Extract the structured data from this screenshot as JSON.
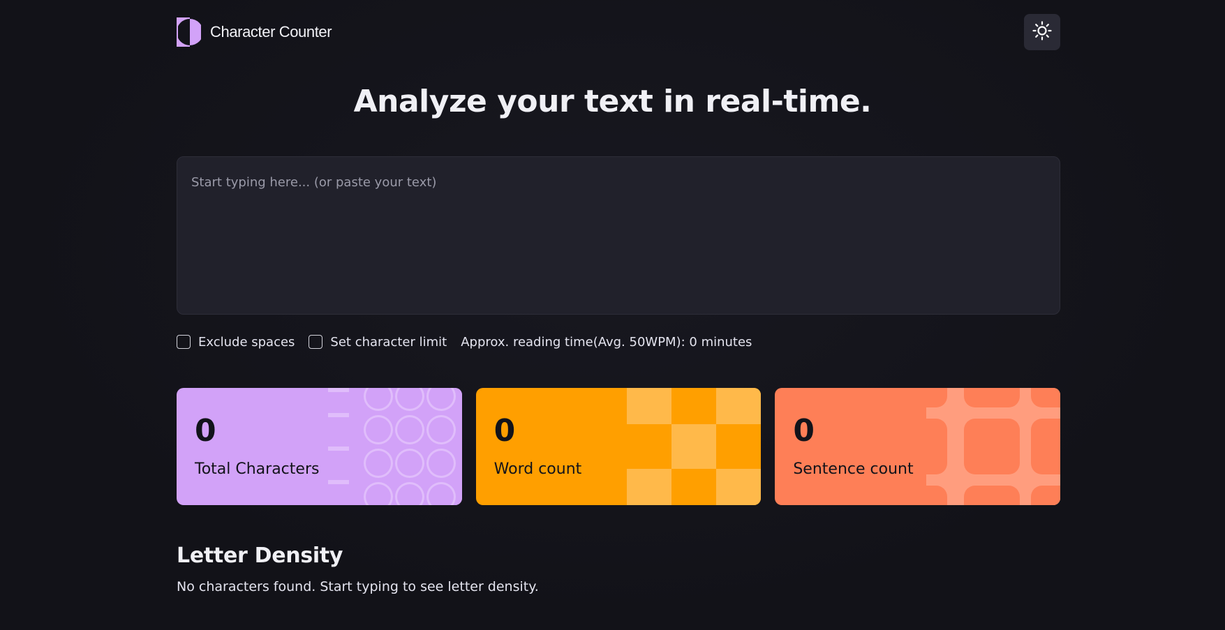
{
  "header": {
    "app_name": "Character Counter",
    "logo_icon": "half-circle-logo-icon",
    "theme_icon": "sun-icon"
  },
  "main": {
    "headline": "Analyze your text in real-time.",
    "textarea": {
      "placeholder": "Start typing here... (or paste your text)",
      "value": ""
    },
    "options": {
      "exclude_spaces_label": "Exclude spaces",
      "exclude_spaces_checked": false,
      "char_limit_label": "Set character limit",
      "char_limit_checked": false,
      "reading_time": "Approx. reading time(Avg. 50WPM): 0 minutes"
    },
    "stats": [
      {
        "value": "0",
        "label": "Total Characters",
        "color": "#d2a2f8"
      },
      {
        "value": "0",
        "label": "Word count",
        "color": "#ff9f00"
      },
      {
        "value": "0",
        "label": "Sentence count",
        "color": "#fe7f57"
      }
    ],
    "density": {
      "title": "Letter Density",
      "empty_message": "No characters found. Start typing to see letter density."
    }
  },
  "colors": {
    "background": "#13131a",
    "surface": "#21212b",
    "accent_purple": "#d2a2f8",
    "accent_orange": "#ff9f00",
    "accent_coral": "#fe7f57"
  }
}
